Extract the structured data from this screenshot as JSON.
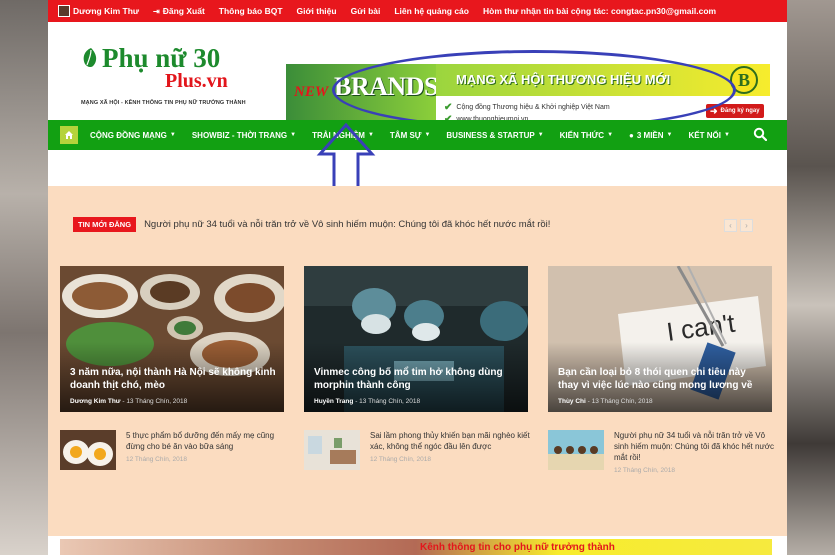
{
  "topbar": {
    "user": "Dương Kim Thư",
    "logout": "Đăng Xuất",
    "links": [
      "Thông báo BQT",
      "Giới thiệu",
      "Gửi bài",
      "Liên hệ quảng cáo"
    ],
    "contact": "Hòm thư nhận tin bài cộng tác: congtac.pn30@gmail.com"
  },
  "logo": {
    "main": "Phụ nữ 30",
    "sub": "Plus.vn",
    "tagline": "MẠNG XÃ HỘI - KÊNH THÔNG TIN PHỤ NỮ TRƯỞNG THÀNH"
  },
  "banner": {
    "new": "NEW",
    "brands": "BRANDS",
    "headline": "MẠNG XÃ HỘI THƯƠNG HIỆU MỚI",
    "badge": "B",
    "line1": "Cộng đồng Thương hiệu & Khởi nghiệp Việt Nam",
    "line2": "www.thuonghieumoi.vn",
    "cta": "Đăng ký ngay"
  },
  "nav": {
    "items": [
      "CỘNG ĐỒNG MẠNG",
      "SHOWBIZ - THỜI TRANG",
      "TRẢI NGHIỆM",
      "TÂM SỰ",
      "BUSINESS & STARTUP",
      "KIẾN THỨC",
      "3 MIỀN",
      "KẾT NỐI"
    ]
  },
  "ticker": {
    "badge": "TIN MỚI ĐĂNG",
    "text": "Người phụ nữ 34 tuổi và nỗi trăn trở về Vô sinh hiếm muộn: Chúng tôi đã khóc hết nước mắt rồi!"
  },
  "featured": [
    {
      "title": "3 năm nữa, nội thành Hà Nội sẽ không kinh doanh thịt chó, mèo",
      "author": "Dương Kim Thư",
      "date": "13 Tháng Chín, 2018"
    },
    {
      "title": "Vinmec công bố mổ tim hở không dùng morphin thành công",
      "author": "Huyền Trang",
      "date": "13 Tháng Chín, 2018"
    },
    {
      "title": "Bạn cần loại bỏ 8 thói quen chi tiêu này thay vì việc lúc nào cũng mong lương về",
      "author": "Thùy Chi",
      "date": "13 Tháng Chín, 2018"
    }
  ],
  "small_posts": [
    {
      "title": "5 thực phẩm bổ dưỡng đến mấy mẹ cũng đừng cho bé ăn vào bữa sáng",
      "date": "12 Tháng Chín, 2018"
    },
    {
      "title": "Sai lầm phong thủy khiến bạn mãi nghèo kiết xác, không thể ngóc đầu lên được",
      "date": "12 Tháng Chín, 2018"
    },
    {
      "title": "Người phụ nữ 34 tuổi và nỗi trăn trở về Vô sinh hiếm muộn: Chúng tôi đã khóc hết nước mắt rồi!",
      "date": "12 Tháng Chín, 2018"
    }
  ],
  "bottom": {
    "text": "Kênh thông tin cho phụ nữ trưởng thành"
  },
  "colors": {
    "red": "#e8171d",
    "green": "#12a012",
    "panel": "#fbdcc0",
    "annotation": "#3940b8"
  },
  "icons": {
    "home": "home-icon",
    "search": "search-icon",
    "logout": "logout-icon",
    "check": "check-icon"
  }
}
